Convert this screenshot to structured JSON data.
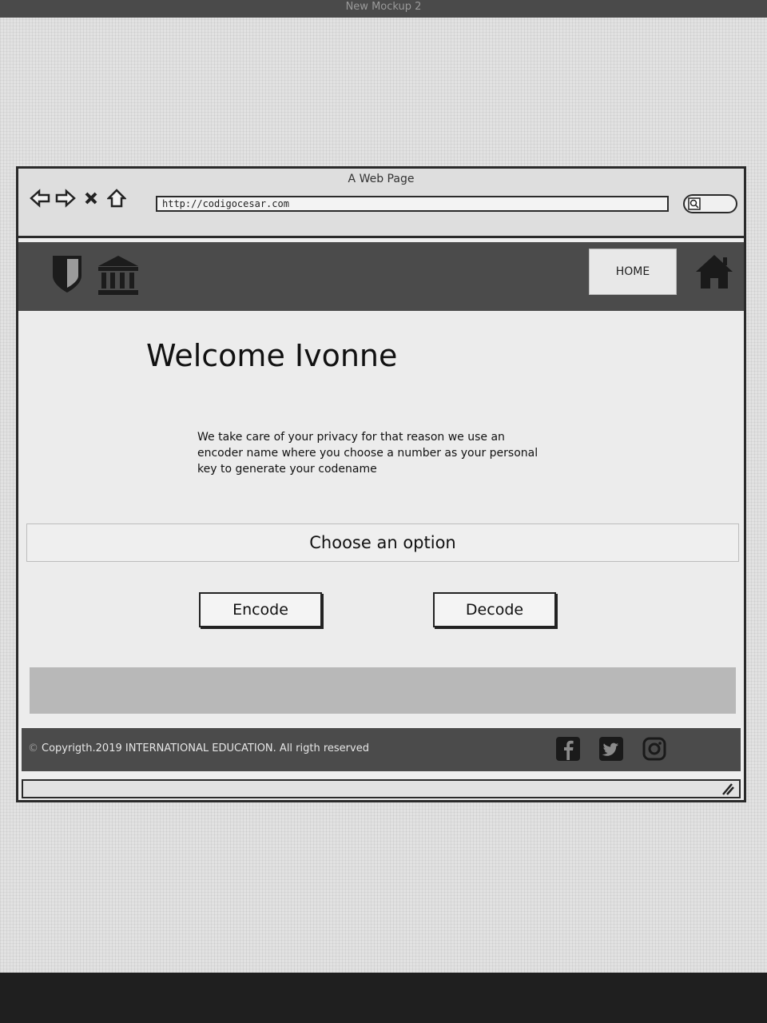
{
  "app": {
    "title": "New Mockup 2"
  },
  "browser": {
    "title": "A Web Page",
    "url": "http://codigocesar.com",
    "icons": [
      "back-arrow-icon",
      "forward-arrow-icon",
      "close-icon",
      "home-outline-icon",
      "search-icon"
    ]
  },
  "site_nav": {
    "logos": [
      "shield-icon",
      "bank-icon"
    ],
    "home_label": "HOME",
    "home_icon": "house-icon"
  },
  "main": {
    "welcome": "Welcome Ivonne",
    "privacy_text": "We take care of your privacy for that reason we use an encoder name where you choose a number as your personal key to generate your codename",
    "choose_label": "Choose an option",
    "encode_label": "Encode",
    "decode_label": "Decode"
  },
  "footer": {
    "copyright": "Copyrigth.2019 INTERNATIONAL EDUCATION. All rigth reserved",
    "copyright_symbol": "©",
    "social": [
      "facebook-icon",
      "twitter-icon",
      "instagram-icon"
    ]
  },
  "colors": {
    "dark_bar": "#4b4b4b",
    "content_bg": "#ececec",
    "band": "#b8b8b8"
  }
}
